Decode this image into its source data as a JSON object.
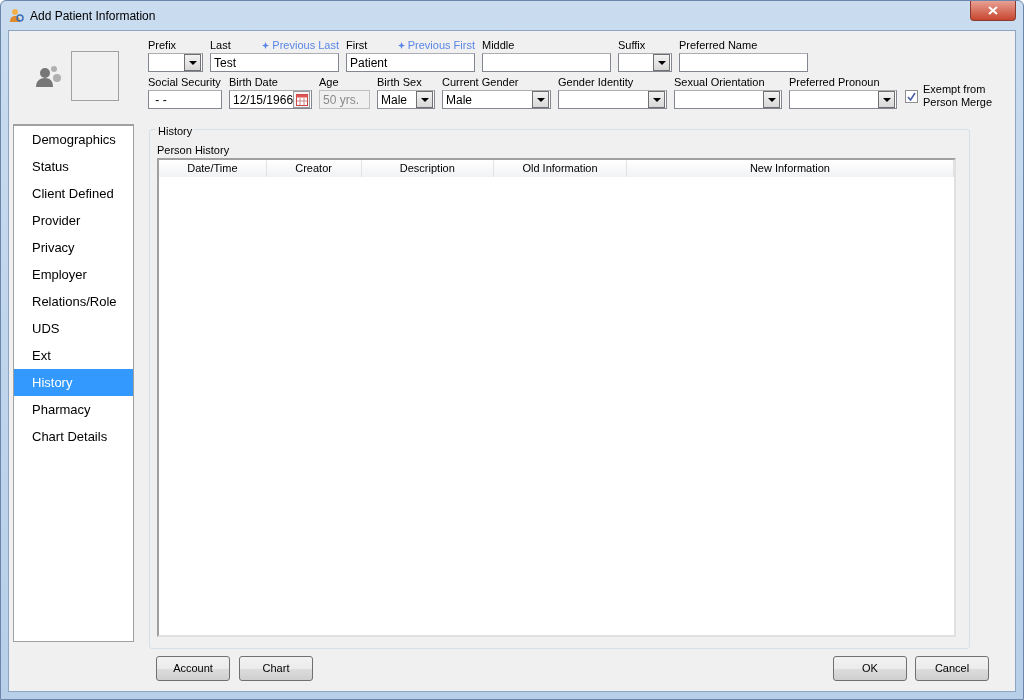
{
  "window": {
    "title": "Add Patient Information"
  },
  "fields_row_1": [
    {
      "kind": "combo",
      "label": "Prefix"
    },
    {
      "kind": "text",
      "label": "Last",
      "value": "Test",
      "link": "Previous Last"
    },
    {
      "kind": "text",
      "label": "First",
      "value": "Patient",
      "link": "Previous First"
    },
    {
      "kind": "text",
      "label": "Middle"
    },
    {
      "kind": "combo",
      "label": "Suffix"
    },
    {
      "kind": "text",
      "label": "Preferred Name"
    }
  ],
  "fields_row_2": [
    {
      "kind": "text",
      "label": "Social Security",
      "value": " - -"
    },
    {
      "kind": "date",
      "label": "Birth Date",
      "value": "12/15/1966"
    },
    {
      "kind": "readonly",
      "label": "Age",
      "value": "50 yrs."
    },
    {
      "kind": "combo",
      "label": "Birth Sex",
      "value": "Male"
    },
    {
      "kind": "combo",
      "label": "Current Gender",
      "value": "Male"
    },
    {
      "kind": "combo",
      "label": "Gender Identity"
    },
    {
      "kind": "combo",
      "label": "Sexual Orientation"
    },
    {
      "kind": "combo",
      "label": "Preferred Pronoun"
    }
  ],
  "exempt_checkbox": {
    "label": "Exempt from Person Merge",
    "checked": true
  },
  "sidebar": {
    "items": [
      {
        "label": "Demographics",
        "selected": false
      },
      {
        "label": "Status",
        "selected": false
      },
      {
        "label": "Client Defined",
        "selected": false
      },
      {
        "label": "Provider",
        "selected": false
      },
      {
        "label": "Privacy",
        "selected": false
      },
      {
        "label": "Employer",
        "selected": false
      },
      {
        "label": "Relations/Role",
        "selected": false
      },
      {
        "label": "UDS",
        "selected": false
      },
      {
        "label": "Ext",
        "selected": false
      },
      {
        "label": "History",
        "selected": true
      },
      {
        "label": "Pharmacy",
        "selected": false
      },
      {
        "label": "Chart Details",
        "selected": false
      }
    ]
  },
  "history": {
    "group_title": "History",
    "table_title": "Person History",
    "columns": [
      "Date/Time",
      "Creator",
      "Description",
      "Old Information",
      "New Information"
    ]
  },
  "buttons_left": [
    "Account",
    "Chart"
  ],
  "buttons_right": [
    "OK",
    "Cancel"
  ]
}
